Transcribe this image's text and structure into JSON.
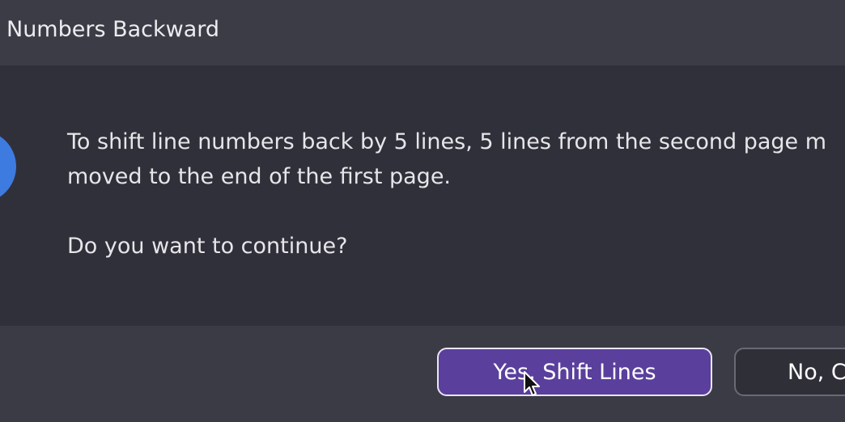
{
  "dialog": {
    "title": "Numbers Backward",
    "message_line1": "To shift line numbers back by 5 lines, 5 lines from the second page m",
    "message_line2": "moved to the end of the first page.",
    "question": "Do you want to continue?",
    "icon": "info-icon",
    "accent_color": "#3d7be0"
  },
  "buttons": {
    "confirm_label": "Yes, Shift Lines",
    "cancel_label": "No, C",
    "confirm_color": "#5a3f9c"
  }
}
